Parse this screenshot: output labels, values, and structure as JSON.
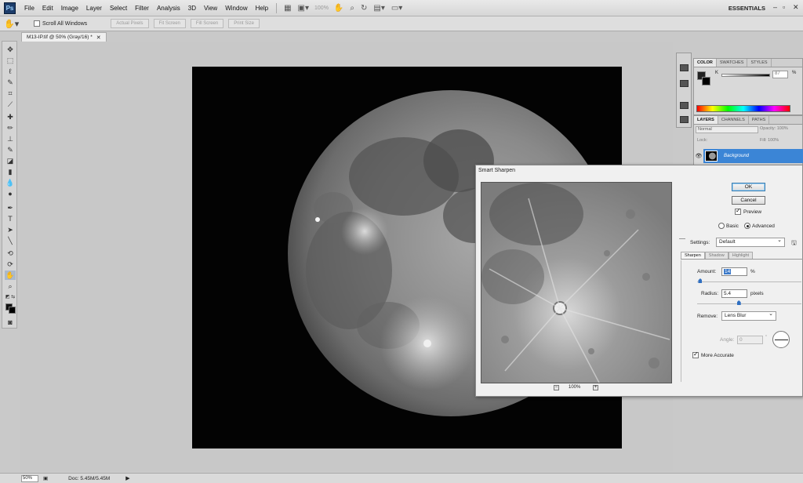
{
  "menu": {
    "logo": "Ps",
    "items": [
      "File",
      "Edit",
      "Image",
      "Layer",
      "Select",
      "Filter",
      "Analysis",
      "3D",
      "View",
      "Window",
      "Help"
    ],
    "zoom": "100%",
    "workspace": "ESSENTIALS"
  },
  "options": {
    "scroll_all_windows": "Scroll All Windows",
    "buttons": [
      "Actual Pixels",
      "Fit Screen",
      "Fill Screen",
      "Print Size"
    ]
  },
  "document": {
    "tab_title": "M13-IP.tif @ 50% (Gray/16) *"
  },
  "status": {
    "zoom": "50%",
    "doc": "Doc: 5.45M/5.45M"
  },
  "color_panel": {
    "tabs": [
      "COLOR",
      "SWATCHES",
      "STYLES"
    ],
    "k_label": "K",
    "k_value": "87",
    "k_unit": "%"
  },
  "layers_panel": {
    "tabs": [
      "LAYERS",
      "CHANNELS",
      "PATHS"
    ],
    "blend_mode": "Normal",
    "opacity_label": "Opacity: 100%",
    "lock_label": "Lock:",
    "fill_label": "Fill: 100%",
    "layer_name": "Background"
  },
  "dialog": {
    "title": "Smart Sharpen",
    "ok": "OK",
    "cancel": "Cancel",
    "preview": "Preview",
    "basic": "Basic",
    "advanced": "Advanced",
    "settings_label": "Settings:",
    "settings_value": "Default",
    "tabs": [
      "Sharpen",
      "Shadow",
      "Highlight"
    ],
    "amount_label": "Amount:",
    "amount_value": "14",
    "amount_unit": "%",
    "amount_level": 0.03,
    "radius_label": "Radius:",
    "radius_value": "5.4",
    "radius_unit": "pixels",
    "radius_level": 0.4,
    "remove_label": "Remove:",
    "remove_value": "Lens Blur",
    "angle_label": "Angle:",
    "angle_value": "0",
    "more_accurate": "More Accurate",
    "preview_zoom": "100%"
  }
}
